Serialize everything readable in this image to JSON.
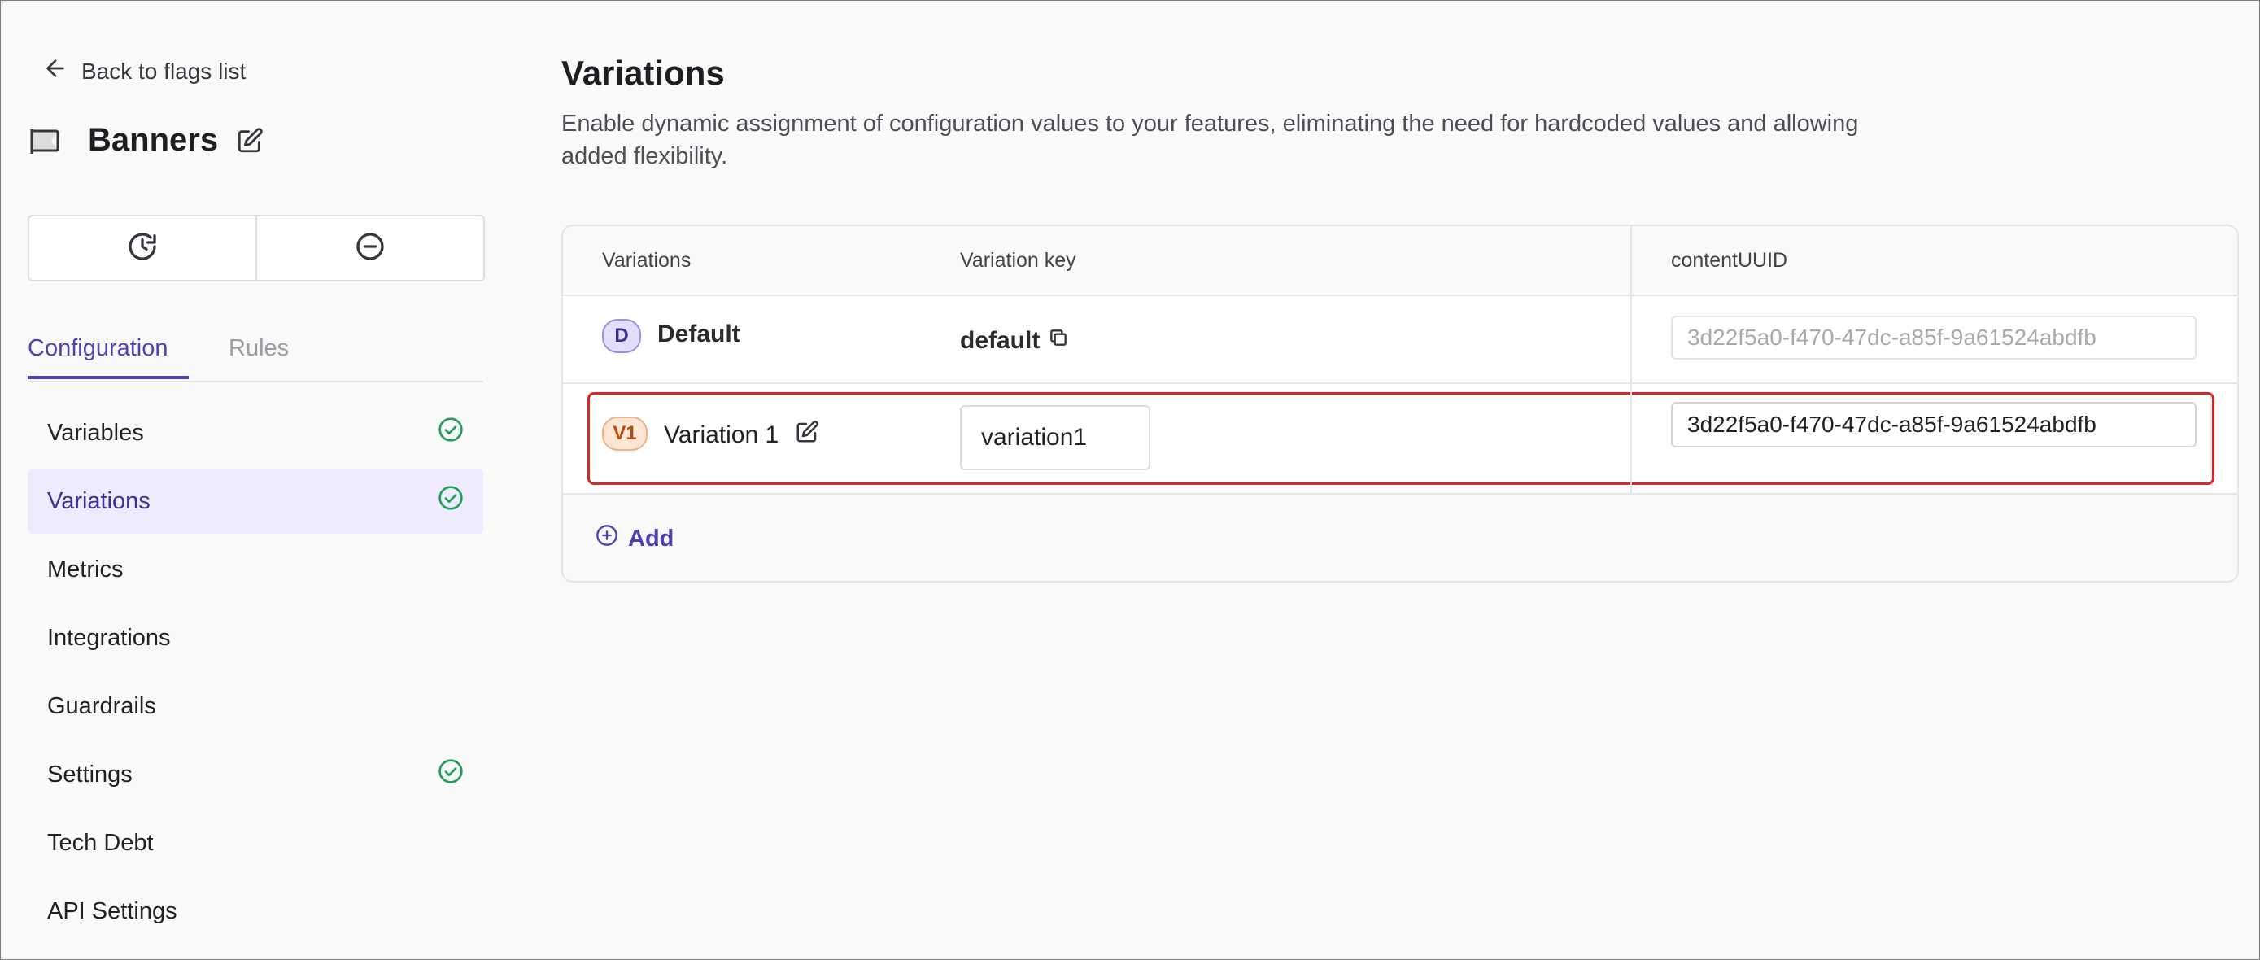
{
  "sidebar": {
    "back_label": "Back to flags list",
    "flag_name": "Banners",
    "tabs": [
      {
        "label": "Configuration",
        "active": true
      },
      {
        "label": "Rules",
        "active": false
      }
    ],
    "items": [
      {
        "label": "Variables",
        "checked": true,
        "active": false
      },
      {
        "label": "Variations",
        "checked": true,
        "active": true
      },
      {
        "label": "Metrics",
        "checked": false,
        "active": false
      },
      {
        "label": "Integrations",
        "checked": false,
        "active": false
      },
      {
        "label": "Guardrails",
        "checked": false,
        "active": false
      },
      {
        "label": "Settings",
        "checked": true,
        "active": false
      },
      {
        "label": "Tech Debt",
        "checked": false,
        "active": false
      },
      {
        "label": "API Settings",
        "checked": false,
        "active": false
      }
    ]
  },
  "main": {
    "title": "Variations",
    "description": "Enable dynamic assignment of configuration values to your features, eliminating the need for hardcoded values and allowing added flexibility.",
    "table": {
      "headers": [
        "Variations",
        "Variation key",
        "contentUUID"
      ],
      "rows": [
        {
          "badge": "D",
          "name": "Default",
          "key": "default",
          "content_uuid": "3d22f5a0-f470-47dc-a85f-9a61524abdfb"
        },
        {
          "badge": "V1",
          "name": "Variation 1",
          "key": "variation1",
          "content_uuid": "3d22f5a0-f470-47dc-a85f-9a61524abdfb"
        }
      ]
    },
    "add_label": "Add"
  },
  "colors": {
    "accent": "#4e3fb5",
    "success": "#1f9e5a",
    "highlight": "#e02424"
  }
}
